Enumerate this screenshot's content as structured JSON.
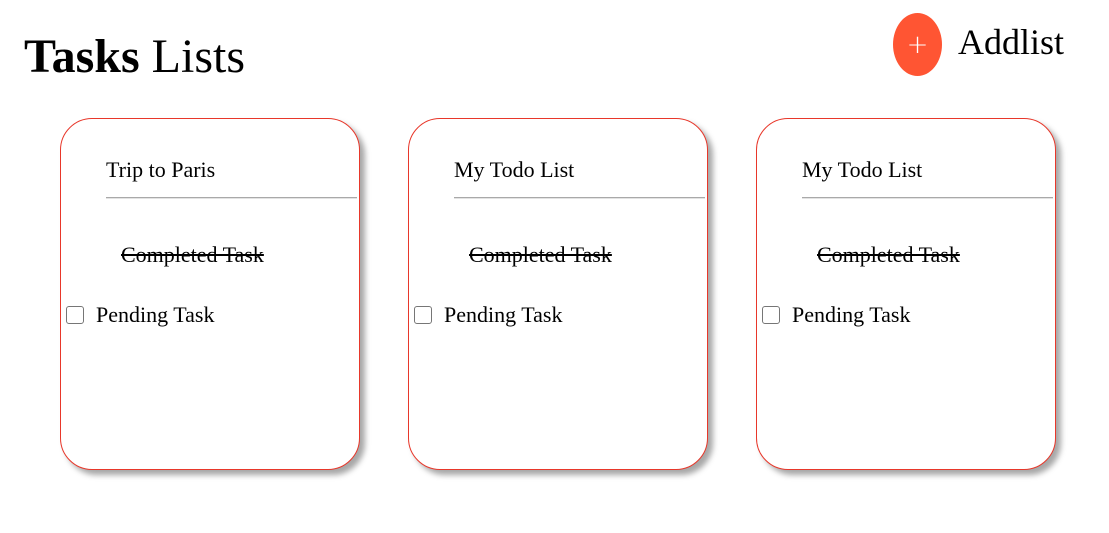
{
  "header": {
    "title_bold": "Tasks",
    "title_rest": " Lists",
    "add_icon": "+",
    "add_label": "Addlist",
    "accent_color": "#ff5533"
  },
  "lists": [
    {
      "title": "Trip to Paris",
      "completed_task": "Completed Task",
      "pending_task": "Pending Task",
      "pending_checked": false
    },
    {
      "title": "My Todo List",
      "completed_task": "Completed Task",
      "pending_task": "Pending Task",
      "pending_checked": false
    },
    {
      "title": "My Todo List",
      "completed_task": "Completed Task",
      "pending_task": "Pending Task",
      "pending_checked": false
    }
  ],
  "colors": {
    "card_border": "#e8372a",
    "divider": "#a9a9a9"
  }
}
